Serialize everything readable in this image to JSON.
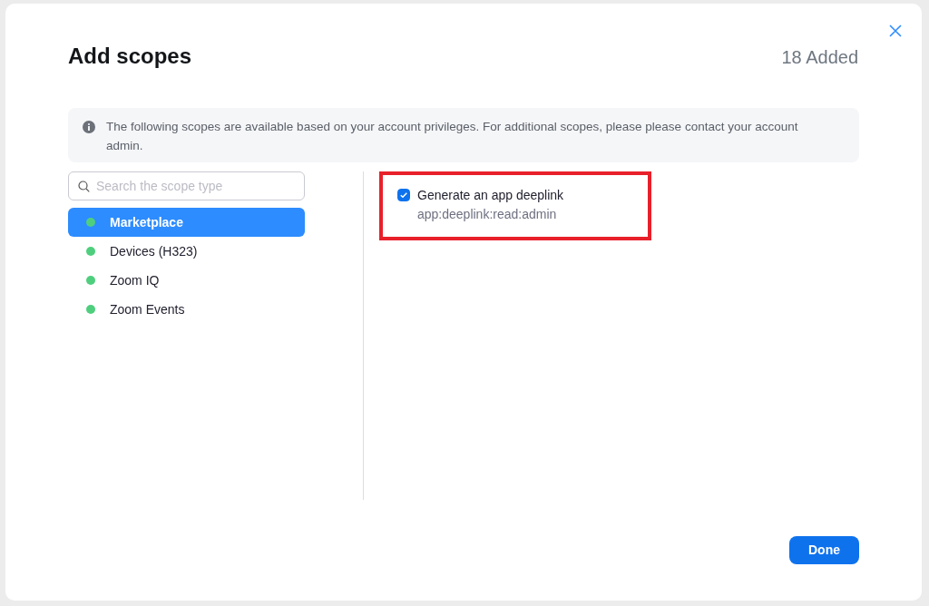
{
  "dialog": {
    "title": "Add scopes",
    "added_count": "18 Added"
  },
  "notice": {
    "text": "The following scopes are available based on your account privileges. For additional scopes, please please contact your account admin."
  },
  "search": {
    "placeholder": "Search the scope type"
  },
  "categories": [
    {
      "label": "Marketplace",
      "selected": true,
      "color": "#4fcf7e"
    },
    {
      "label": "Devices (H323)",
      "selected": false,
      "color": "#4fcf7e"
    },
    {
      "label": "Zoom IQ",
      "selected": false,
      "color": "#4fcf7e"
    },
    {
      "label": "Zoom Events",
      "selected": false,
      "color": "#4fcf7e"
    }
  ],
  "scopes": [
    {
      "name": "Generate an app deeplink",
      "scope": "app:deeplink:read:admin",
      "checked": true,
      "highlighted": true
    }
  ],
  "buttons": [
    {
      "label": "Done"
    }
  ]
}
